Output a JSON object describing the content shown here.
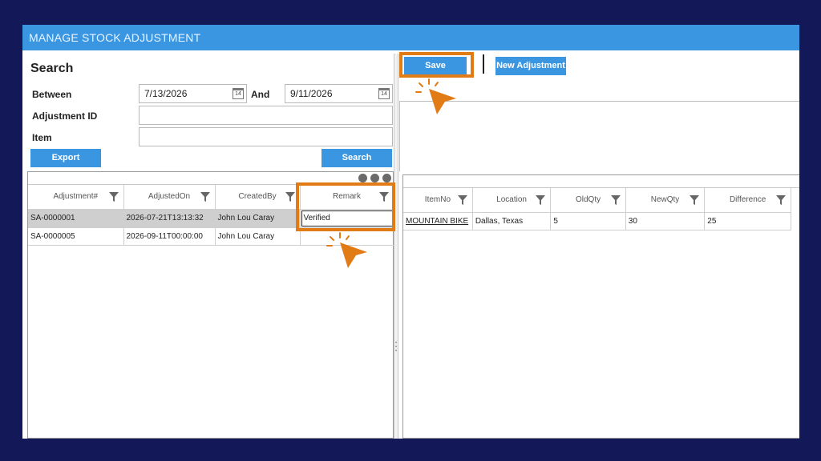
{
  "window": {
    "title": "MANAGE STOCK ADJUSTMENT"
  },
  "search": {
    "title": "Search",
    "between_label": "Between",
    "from_date": "7/13/2026",
    "and_label": "And",
    "to_date": "9/11/2026",
    "adjustment_id_label": "Adjustment ID",
    "adjustment_id_value": "",
    "item_label": "Item",
    "item_value": "",
    "export_label": "Export",
    "search_label": "Search",
    "calendar_glyph": "14"
  },
  "adjustments_grid": {
    "columns": [
      "Adjustment#",
      "AdjustedOn",
      "CreatedBy",
      "Remark"
    ],
    "rows": [
      {
        "id": "SA-0000001",
        "adjusted_on": "2026-07-21T13:13:32",
        "created_by": "John Lou Caray",
        "remark": "Verified",
        "selected": true
      },
      {
        "id": "SA-0000005",
        "adjusted_on": "2026-09-11T00:00:00",
        "created_by": "John Lou Caray",
        "remark": "",
        "selected": false
      }
    ]
  },
  "toolbar": {
    "save_label": "Save",
    "new_adjustment_label": "New Adjustment"
  },
  "details_grid": {
    "columns": [
      "ItemNo",
      "Location",
      "OldQty",
      "NewQty",
      "Difference"
    ],
    "rows": [
      {
        "item_no": "MOUNTAIN BIKE",
        "location": "Dallas, Texas",
        "old_qty": "5",
        "new_qty": "30",
        "difference": "25"
      }
    ]
  },
  "colors": {
    "accent": "#3b96e2",
    "highlight": "#e07b16",
    "background": "#121858"
  },
  "icons": [
    "calendar-icon",
    "filter-icon",
    "more-dots-icon",
    "click-cursor-icon"
  ]
}
